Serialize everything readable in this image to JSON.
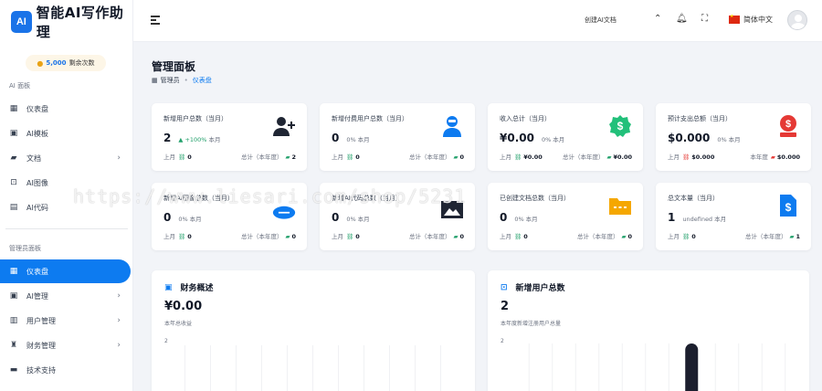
{
  "brand": {
    "badge": "AI",
    "name": "智能AI写作助理"
  },
  "credits": {
    "amount": "5,000",
    "label": "剩余次数"
  },
  "sidebar": {
    "section_ai": "AI 面板",
    "ai_items": [
      {
        "label": "仪表盘",
        "icon": "grid-icon"
      },
      {
        "label": "AI模板",
        "icon": "ai-chip-icon"
      },
      {
        "label": "文档",
        "icon": "folder-icon",
        "has_children": true
      },
      {
        "label": "AI图像",
        "icon": "image-scan-icon"
      },
      {
        "label": "AI代码",
        "icon": "code-icon"
      }
    ],
    "section_admin": "管理员面板",
    "admin_items": [
      {
        "label": "仪表盘",
        "icon": "grid-icon",
        "active": true
      },
      {
        "label": "AI管理",
        "icon": "ai-chip-icon",
        "has_children": true
      },
      {
        "label": "用户管理",
        "icon": "user-doc-icon",
        "has_children": true
      },
      {
        "label": "财务管理",
        "icon": "money-bag-icon",
        "has_children": true
      },
      {
        "label": "技术支持",
        "icon": "support-chat-icon"
      }
    ]
  },
  "topbar": {
    "create_label": "创建AI文档",
    "language": "简体中文"
  },
  "page": {
    "title": "管理面板",
    "breadcrumb_home": "管理员",
    "breadcrumb_current": "仪表盘"
  },
  "cards": [
    {
      "title": "新增用户总数（当月）",
      "value": "2",
      "pct": "+100%",
      "pct_unit": "本月",
      "pct_up": true,
      "left_label": "上月",
      "left_value": "0",
      "right_label": "总计（本年度）",
      "right_value": "2",
      "icon": "user-plus-icon",
      "icon_color": "#1f2533"
    },
    {
      "title": "新增付费用户总数（当月）",
      "value": "0",
      "pct": "0%",
      "pct_unit": "本月",
      "pct_up": false,
      "left_label": "上月",
      "left_value": "0",
      "right_label": "总计（本年度）",
      "right_value": "0",
      "icon": "user-badge-icon",
      "icon_color": "#0d7bf0"
    },
    {
      "title": "收入总计（当月）",
      "value": "¥0.00",
      "pct": "0%",
      "pct_unit": "本月",
      "pct_up": false,
      "left_label": "上月",
      "left_value": "¥0.00",
      "right_label": "总计（本年度）",
      "right_value": "¥0.00",
      "icon": "dollar-badge-icon",
      "icon_color": "#22c07a"
    },
    {
      "title": "预计支出总额（当月）",
      "value": "$0.000",
      "pct": "0%",
      "pct_unit": "本月",
      "pct_up": false,
      "left_label": "上月",
      "left_value": "$0.000",
      "right_label": "本年度",
      "right_value": "$0.000",
      "icon": "payout-icon",
      "icon_color": "#e53935"
    },
    {
      "title": "新增AI图像总数（当月）",
      "value": "0",
      "pct": "0%",
      "pct_unit": "本月",
      "pct_up": false,
      "left_label": "上月",
      "left_value": "0",
      "right_label": "总计（本年度）",
      "right_value": "0",
      "icon": "cloud-icon",
      "icon_color": "#0d7bf0"
    },
    {
      "title": "新增AI代码总数（当月）",
      "value": "0",
      "pct": "0%",
      "pct_unit": "本月",
      "pct_up": false,
      "left_label": "上月",
      "left_value": "0",
      "right_label": "总计（本年度）",
      "right_value": "0",
      "icon": "image-icon",
      "icon_color": "#1f2533"
    },
    {
      "title": "已创建文档总数（当月）",
      "value": "0",
      "pct": "0%",
      "pct_unit": "本月",
      "pct_up": false,
      "left_label": "上月",
      "left_value": "0",
      "right_label": "总计（本年度）",
      "right_value": "0",
      "icon": "folder-icon",
      "icon_color": "#f5a700"
    },
    {
      "title": "总文本量（当月）",
      "value": "1",
      "pct": "undefined",
      "pct_unit": "本月",
      "pct_up": false,
      "left_label": "上月",
      "left_value": "0",
      "right_label": "总计（本年度）",
      "right_value": "1",
      "icon": "dollar-doc-icon",
      "icon_color": "#0d7bf0"
    }
  ],
  "panels": [
    {
      "title": "财务概述",
      "value": "¥0.00",
      "subtitle": "本年总收益",
      "tick": "2",
      "icon": "wallet-icon"
    },
    {
      "title": "新增用户总数",
      "value": "2",
      "subtitle": "本年度新增注册用户总量",
      "tick": "2",
      "icon": "user-scan-icon"
    }
  ],
  "chart_data": {
    "type": "bar",
    "title": "新增用户总数",
    "categories": [
      "",
      "",
      "",
      "",
      "",
      "",
      "",
      "",
      "",
      "",
      "",
      ""
    ],
    "values": [
      0,
      0,
      0,
      0,
      0,
      0,
      0,
      2,
      0,
      0,
      0,
      0
    ],
    "ylim": [
      0,
      2
    ]
  },
  "watermark": "https://www.liesari.com/shop/5231"
}
